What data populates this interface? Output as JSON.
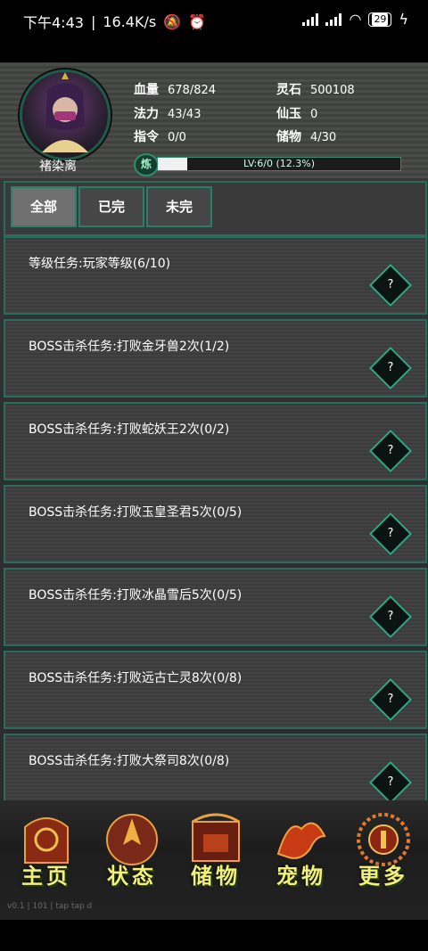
{
  "statusbar": {
    "time": "下午4:43",
    "speed": "16.4K/s",
    "battery": "29"
  },
  "player": {
    "name": "褚染离",
    "stats": [
      {
        "key": "血量",
        "value": "678/824"
      },
      {
        "key": "灵石",
        "value": "500108"
      },
      {
        "key": "法力",
        "value": "43/43"
      },
      {
        "key": "仙玉",
        "value": "0"
      },
      {
        "key": "指令",
        "value": "0/0"
      },
      {
        "key": "储物",
        "value": "4/30"
      }
    ],
    "level_badge": "炼",
    "level_text": "LV:6/0 (12.3%)",
    "level_progress": 0.123
  },
  "tabs": [
    {
      "label": "全部",
      "active": true
    },
    {
      "label": "已完",
      "active": false
    },
    {
      "label": "未完",
      "active": false
    }
  ],
  "tasks": [
    {
      "label": "等级任务:玩家等级(6/10)",
      "button": "?"
    },
    {
      "label": "BOSS击杀任务:打败金牙兽2次(1/2)",
      "button": "?"
    },
    {
      "label": "BOSS击杀任务:打败蛇妖王2次(0/2)",
      "button": "?"
    },
    {
      "label": "BOSS击杀任务:打败玉皇圣君5次(0/5)",
      "button": "?"
    },
    {
      "label": "BOSS击杀任务:打败冰晶雪后5次(0/5)",
      "button": "?"
    },
    {
      "label": "BOSS击杀任务:打败远古亡灵8次(0/8)",
      "button": "?"
    },
    {
      "label": "BOSS击杀任务:打败大祭司8次(0/8)",
      "button": "?"
    }
  ],
  "nav": [
    {
      "label": "主页",
      "icon": "home-emblem-icon"
    },
    {
      "label": "状态",
      "icon": "status-emblem-icon"
    },
    {
      "label": "储物",
      "icon": "storage-emblem-icon"
    },
    {
      "label": "宠物",
      "icon": "pet-emblem-icon"
    },
    {
      "label": "更多",
      "icon": "more-emblem-icon"
    }
  ],
  "version": "v0.1 | 101 | tap tap d"
}
